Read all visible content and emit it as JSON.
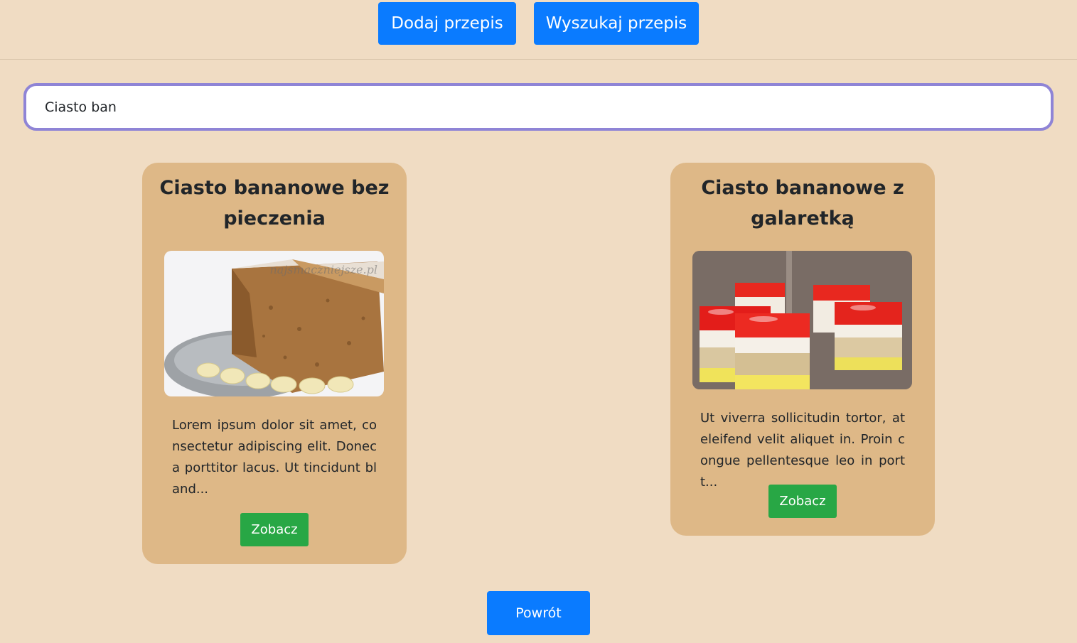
{
  "header": {
    "add_label": "Dodaj przepis",
    "search_label": "Wyszukaj przepis"
  },
  "search": {
    "value": "Ciasto ban"
  },
  "recipes": [
    {
      "title": "Ciasto bananowe bez pieczenia",
      "description": "Lorem ipsum dolor sit amet, consectetur adipiscing elit. Donec a porttitor lacus. Ut tincidunt bland...",
      "button": "Zobacz",
      "image_watermark": "najsmaczniejsze.pl"
    },
    {
      "title": "Ciasto bananowe z galaretką",
      "description": "Ut viverra sollicitudin tortor, at eleifend velit aliquet in. Proin congue pellentesque leo in portt...",
      "button": "Zobacz"
    }
  ],
  "footer": {
    "back_label": "Powrót"
  },
  "colors": {
    "background": "#f0dcc3",
    "card": "#deb887",
    "primary": "#0a7bff",
    "success": "#28a745",
    "focus_border": "#8f84d6"
  }
}
